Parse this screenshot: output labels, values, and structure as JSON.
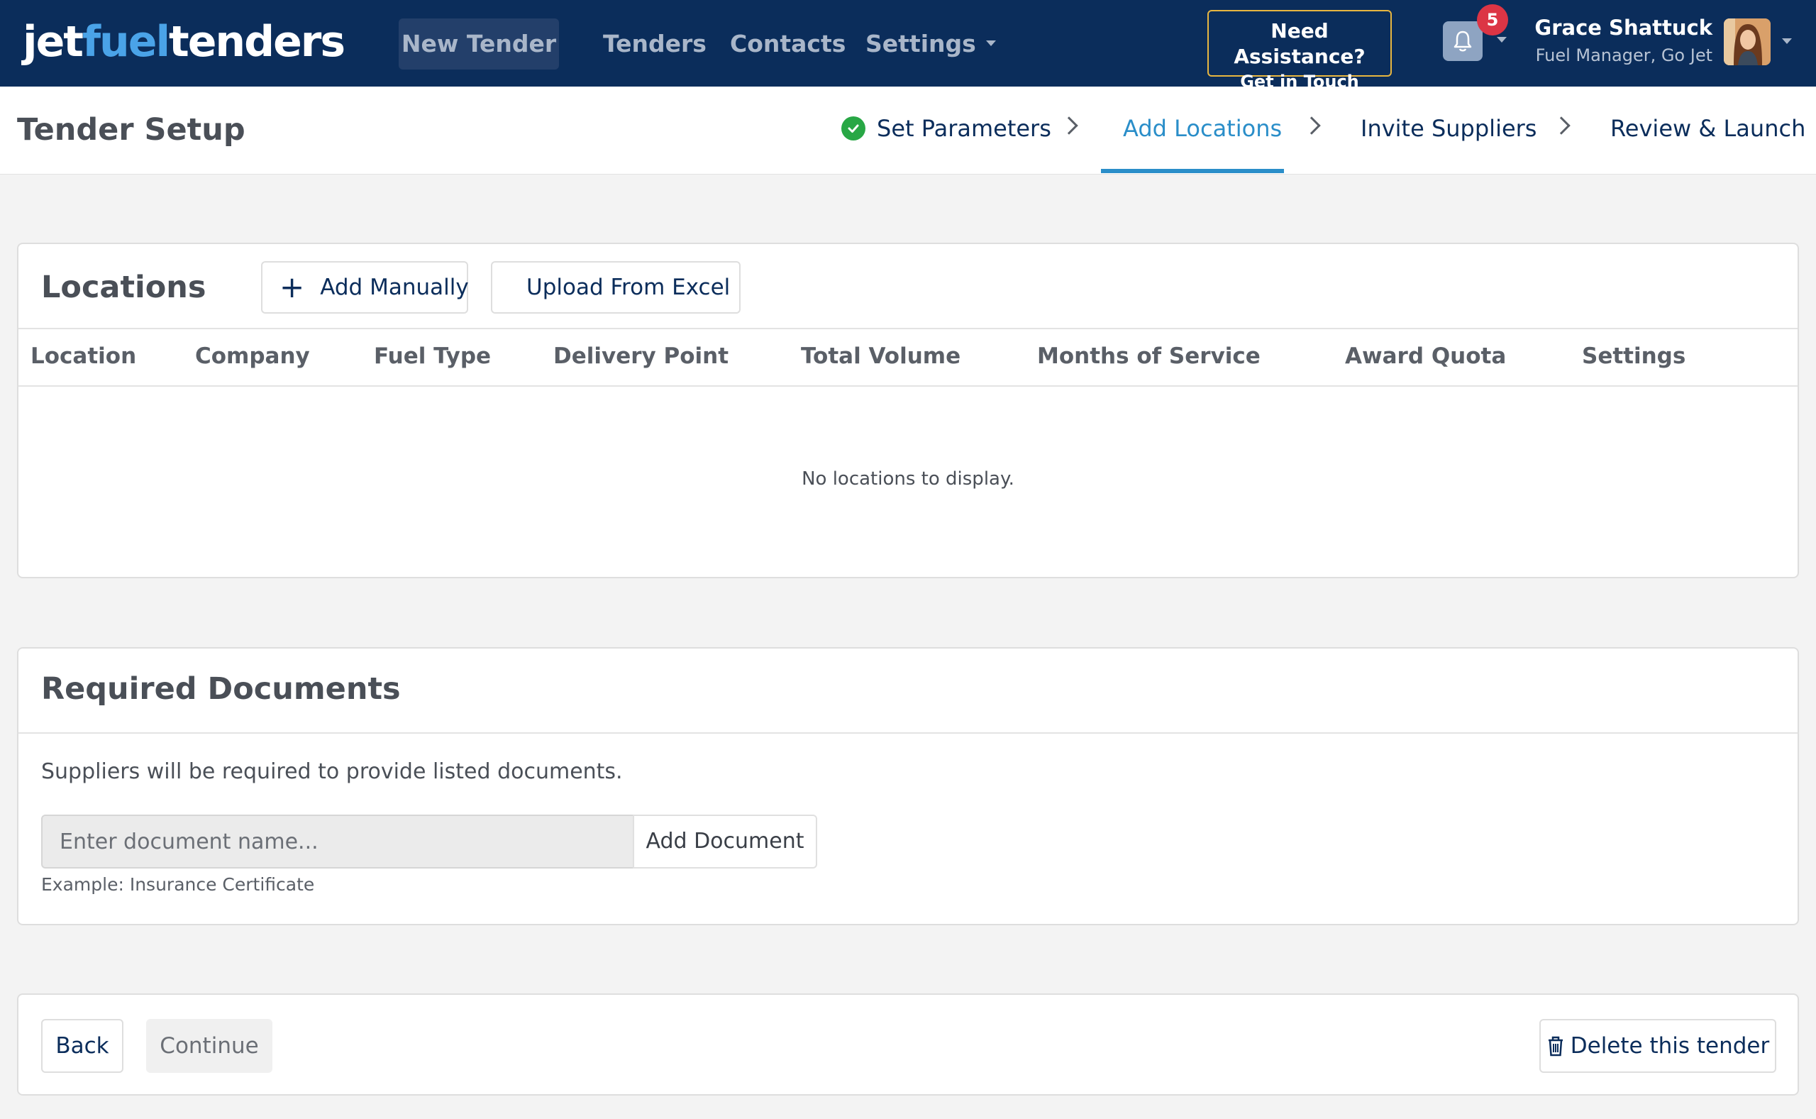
{
  "brand": {
    "part1": "jet",
    "part2": "fuel",
    "part3": "tenders"
  },
  "nav": {
    "new_tender": "New Tender",
    "tenders": "Tenders",
    "contacts": "Contacts",
    "settings": "Settings"
  },
  "assist": {
    "line1": "Need Assistance?",
    "line2": "Get in Touch"
  },
  "notifications": {
    "count": "5"
  },
  "user": {
    "name": "Grace Shattuck",
    "role": "Fuel Manager, Go Jet"
  },
  "page": {
    "title": "Tender Setup"
  },
  "steps": [
    {
      "label": "Set Parameters",
      "state": "complete"
    },
    {
      "label": "Add Locations",
      "state": "active"
    },
    {
      "label": "Invite Suppliers",
      "state": "pending"
    },
    {
      "label": "Review & Launch",
      "state": "pending"
    }
  ],
  "locations": {
    "title": "Locations",
    "add_manually": "Add Manually",
    "upload_excel": "Upload From Excel",
    "columns": [
      "Location",
      "Company",
      "Fuel Type",
      "Delivery Point",
      "Total Volume",
      "Months of Service",
      "Award Quota",
      "Settings"
    ],
    "empty_message": "No locations to display."
  },
  "documents": {
    "title": "Required Documents",
    "help": "Suppliers will be required to provide listed documents.",
    "input_placeholder": "Enter document name...",
    "add_button": "Add Document",
    "example": "Example: Insurance Certificate"
  },
  "actions": {
    "back": "Back",
    "continue": "Continue",
    "delete": "Delete this tender"
  },
  "colors": {
    "navbar": "#0b2d5b",
    "accent": "#2a8ec9",
    "success": "#28a745",
    "badge": "#dc3545",
    "assist_border": "#e8b640"
  }
}
